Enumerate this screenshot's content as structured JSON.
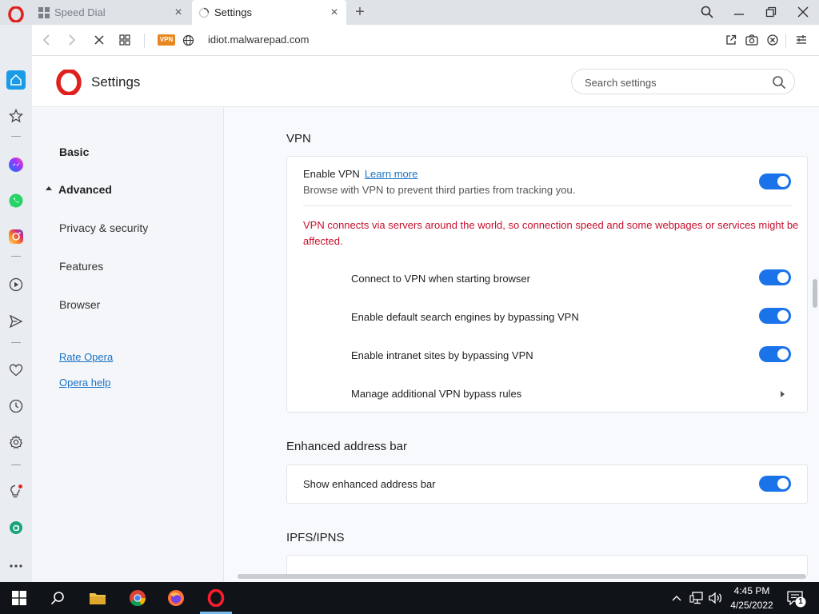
{
  "tabs": [
    {
      "label": "Speed Dial",
      "icon": "speed-dial-icon"
    },
    {
      "label": "Settings",
      "icon": "loading-spinner-icon"
    }
  ],
  "address_bar": {
    "vpn_badge": "VPN",
    "url": "idiot.malwarepad.com"
  },
  "settings": {
    "title": "Settings",
    "search_placeholder": "Search settings"
  },
  "nav": {
    "basic": "Basic",
    "advanced": "Advanced",
    "privacy": "Privacy & security",
    "features": "Features",
    "browser": "Browser",
    "rate": "Rate Opera",
    "help": "Opera help"
  },
  "vpn": {
    "section_title": "VPN",
    "enable_title": "Enable VPN",
    "learn_more": "Learn more",
    "enable_sub": "Browse with VPN to prevent third parties from tracking you.",
    "warning": "VPN connects via servers around the world, so connection speed and some webpages or services might be affected.",
    "options": [
      {
        "label": "Connect to VPN when starting browser",
        "enabled": true
      },
      {
        "label": "Enable default search engines by bypassing VPN",
        "enabled": true
      },
      {
        "label": "Enable intranet sites by bypassing VPN",
        "enabled": true
      }
    ],
    "manage_rules": "Manage additional VPN bypass rules"
  },
  "enhanced": {
    "section_title": "Enhanced address bar",
    "show_label": "Show enhanced address bar",
    "enabled": true
  },
  "ipfs": {
    "section_title": "IPFS/IPNS"
  },
  "taskbar": {
    "time": "4:45 PM",
    "date": "4/25/2022",
    "notifications": "1"
  },
  "colors": {
    "accent": "#1a73e8",
    "opera_red": "#e0201c",
    "warning": "#c8102e",
    "link": "#1a73c5"
  }
}
